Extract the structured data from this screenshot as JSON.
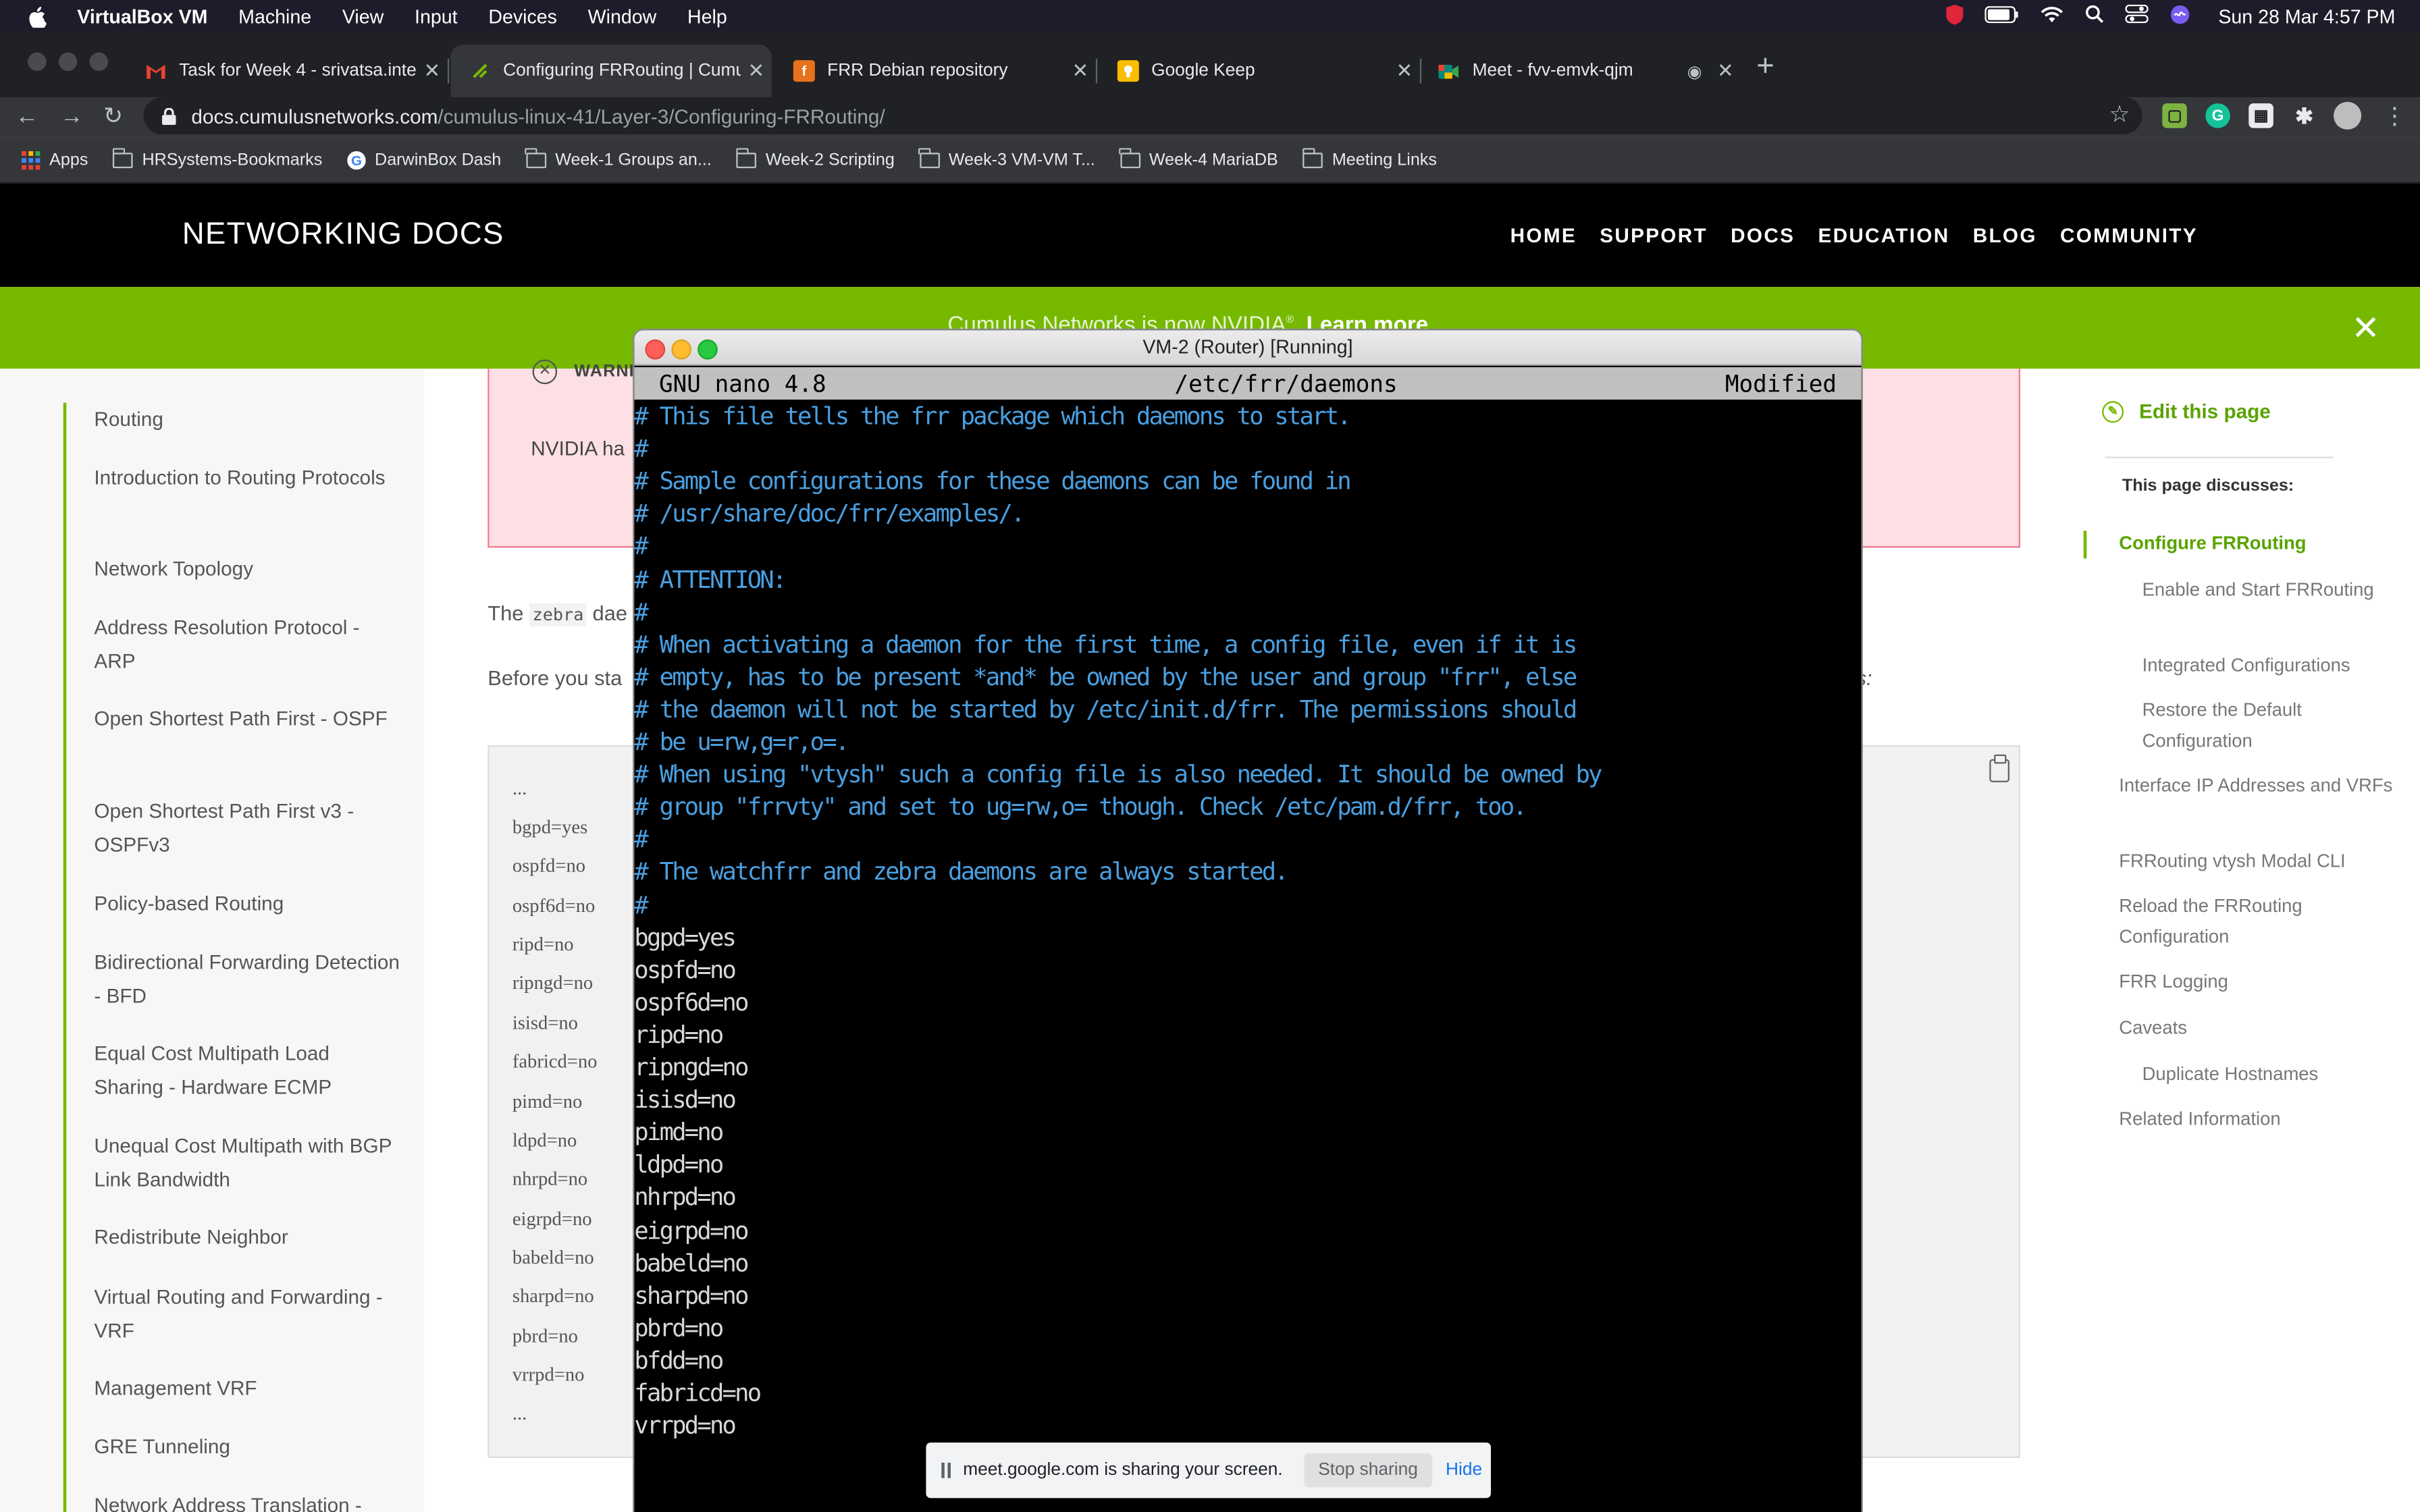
{
  "menubar": {
    "app_name": "VirtualBox VM",
    "items": [
      "Machine",
      "View",
      "Input",
      "Devices",
      "Window",
      "Help"
    ],
    "clock": "Sun 28 Mar  4:57 PM"
  },
  "tabs": [
    {
      "title": "Task for Week 4 - srivatsa.inte",
      "favicon": "gmail-icon",
      "color": "#ea4335"
    },
    {
      "title": "Configuring FRRouting | Cumul",
      "favicon": "cumulus-icon",
      "color": "#76b900"
    },
    {
      "title": "FRR Debian repository",
      "favicon": "frr-icon",
      "color": "#e8711c"
    },
    {
      "title": "Google Keep",
      "favicon": "keep-icon",
      "color": "#fbbc04"
    },
    {
      "title": "Meet - fvv-emvk-qjm",
      "favicon": "meet-icon",
      "color": "#00897b"
    }
  ],
  "address": {
    "host": "docs.cumulusnetworks.com",
    "path": "/cumulus-linux-41/Layer-3/Configuring-FRRouting/"
  },
  "bookmarks": [
    "Apps",
    "HRSystems-Bookmarks",
    "DarwinBox Dash",
    "Week-1 Groups an...",
    "Week-2 Scripting",
    "Week-3 VM-VM T...",
    "Week-4 MariaDB",
    "Meeting Links"
  ],
  "site": {
    "logo": "NETWORKING DOCS",
    "nav": [
      "HOME",
      "SUPPORT",
      "DOCS",
      "EDUCATION",
      "BLOG",
      "COMMUNITY"
    ],
    "banner_text": "Cumulus Networks is now NVIDIA",
    "banner_link": "Learn more"
  },
  "sidebar": {
    "items": [
      "Routing",
      "Introduction to Routing Protocols",
      "Network Topology",
      "Address Resolution Protocol - ARP",
      "Open Shortest Path First - OSPF",
      "Open Shortest Path First v3 - OSPFv3",
      "Policy-based Routing",
      "Bidirectional Forwarding Detection - BFD",
      "Equal Cost Multipath Load Sharing - Hardware ECMP",
      "Unequal Cost Multipath with BGP Link Bandwidth",
      "Redistribute Neighbor",
      "Virtual Routing and Forwarding - VRF",
      "Management VRF",
      "GRE Tunneling",
      "Network Address Translation -"
    ]
  },
  "content": {
    "warning_label": "WARNI",
    "warning_text": "NVIDIA ha",
    "para1_pre": "The",
    "para1_code": "zebra",
    "para1_post": "dae",
    "para2": "Before you sta",
    "para2_end": "o yes:",
    "code_lines": [
      "...",
      "bgpd=yes",
      "ospfd=no",
      "ospf6d=no",
      "ripd=no",
      "ripngd=no",
      "isisd=no",
      "fabricd=no",
      "pimd=no",
      "ldpd=no",
      "nhrpd=no",
      "eigrpd=no",
      "babeld=no",
      "sharpd=no",
      "pbrd=no",
      "vrrpd=no",
      "..."
    ]
  },
  "toc": {
    "edit": "Edit this page",
    "discusses": "This page discusses:",
    "items": [
      {
        "label": "Configure FRRouting",
        "level": 1,
        "active": true
      },
      {
        "label": "Enable and Start FRRouting",
        "level": 2
      },
      {
        "label": "Integrated Configurations",
        "level": 2
      },
      {
        "label": "Restore the Default Configuration",
        "level": 2
      },
      {
        "label": "Interface IP Addresses and VRFs",
        "level": 1
      },
      {
        "label": "FRRouting vtysh Modal CLI",
        "level": 1
      },
      {
        "label": "Reload the FRRouting Configuration",
        "level": 1
      },
      {
        "label": "FRR Logging",
        "level": 1
      },
      {
        "label": "Caveats",
        "level": 1
      },
      {
        "label": "Duplicate Hostnames",
        "level": 2
      },
      {
        "label": "Related Information",
        "level": 1
      }
    ]
  },
  "vm": {
    "title": "VM-2 (Router) [Running]",
    "nano_version": "GNU nano 4.8",
    "file": "/etc/frr/daemons",
    "status": "Modified",
    "lines": [
      "# This file tells the frr package which daemons to start.",
      "#",
      "# Sample configurations for these daemons can be found in",
      "# /usr/share/doc/frr/examples/.",
      "#",
      "# ATTENTION:",
      "#",
      "# When activating a daemon for the first time, a config file, even if it is",
      "# empty, has to be present *and* be owned by the user and group \"frr\", else",
      "# the daemon will not be started by /etc/init.d/frr. The permissions should",
      "# be u=rw,g=r,o=.",
      "# When using \"vtysh\" such a config file is also needed. It should be owned by",
      "# group \"frrvty\" and set to ug=rw,o= though. Check /etc/pam.d/frr, too.",
      "#",
      "# The watchfrr and zebra daemons are always started.",
      "#",
      "bgpd=yes",
      "ospfd=no",
      "ospf6d=no",
      "ripd=no",
      "ripngd=no",
      "isisd=no",
      "pimd=no",
      "ldpd=no",
      "nhrpd=no",
      "eigrpd=no",
      "babeld=no",
      "sharpd=no",
      "pbrd=no",
      "bfdd=no",
      "fabricd=no",
      "vrrpd=no"
    ]
  },
  "share": {
    "message": "meet.google.com is sharing your screen.",
    "stop": "Stop sharing",
    "hide": "Hide"
  }
}
